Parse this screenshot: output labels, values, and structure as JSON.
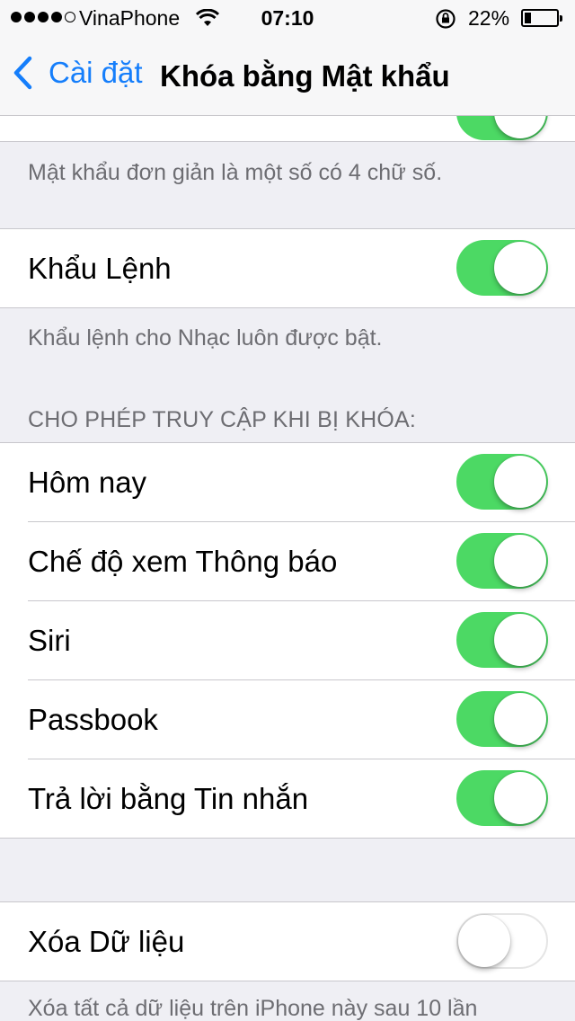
{
  "status_bar": {
    "carrier": "VinaPhone",
    "time": "07:10",
    "battery_percent": "22%",
    "battery_level": 0.22,
    "signal_bars": 4,
    "signal_max": 5
  },
  "nav": {
    "back_label": "Cài đặt",
    "title": "Khóa bằng Mật khẩu"
  },
  "top_group": {
    "simple_passcode_on": true,
    "footer": "Mật khẩu đơn giản là một số có 4 chữ số."
  },
  "voice_dial": {
    "label": "Khẩu Lệnh",
    "on": true,
    "footer": "Khẩu lệnh cho Nhạc luôn được bật."
  },
  "locked_access": {
    "header": "CHO PHÉP TRUY CẬP KHI BỊ KHÓA:",
    "items": [
      {
        "label": "Hôm nay",
        "on": true
      },
      {
        "label": "Chế độ xem Thông báo",
        "on": true
      },
      {
        "label": "Siri",
        "on": true
      },
      {
        "label": "Passbook",
        "on": true
      },
      {
        "label": "Trả lời bằng Tin nhắn",
        "on": true
      }
    ]
  },
  "erase_data": {
    "label": "Xóa Dữ liệu",
    "on": false,
    "footer": "Xóa tất cả dữ liệu trên iPhone này sau 10 lần"
  },
  "colors": {
    "accent": "#157efb",
    "toggle_on": "#4cd964",
    "background": "#efeff4"
  }
}
